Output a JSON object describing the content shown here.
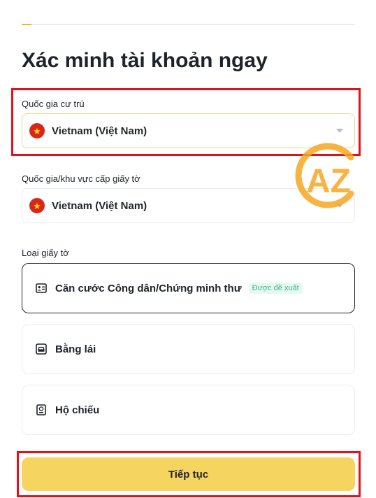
{
  "progress": {
    "value": 0.03
  },
  "page": {
    "title": "Xác minh tài khoản ngay"
  },
  "residence": {
    "label": "Quốc gia cư trú",
    "value": "Vietnam (Việt Nam)",
    "flag_icon": "vietnam-flag-icon"
  },
  "issuing_country": {
    "label": "Quốc gia/khu vực cấp giấy tờ",
    "value": "Vietnam (Việt Nam)",
    "flag_icon": "vietnam-flag-icon"
  },
  "document_type": {
    "label": "Loại giấy tờ",
    "options": [
      {
        "label": "Căn cước Công dân/Chứng minh thư",
        "badge": "Được đề xuất",
        "icon": "id-card-icon",
        "selected": true
      },
      {
        "label": "Bằng lái",
        "icon": "car-icon",
        "selected": false
      },
      {
        "label": "Hộ chiếu",
        "icon": "passport-icon",
        "selected": false
      }
    ]
  },
  "actions": {
    "continue_label": "Tiếp tục"
  },
  "watermark": {
    "text": "AZ"
  },
  "colors": {
    "accent": "#f0b90b",
    "button": "#f6d460",
    "highlight": "#e0131b",
    "badge_text": "#2ebd85",
    "watermark": "#f7a823"
  }
}
